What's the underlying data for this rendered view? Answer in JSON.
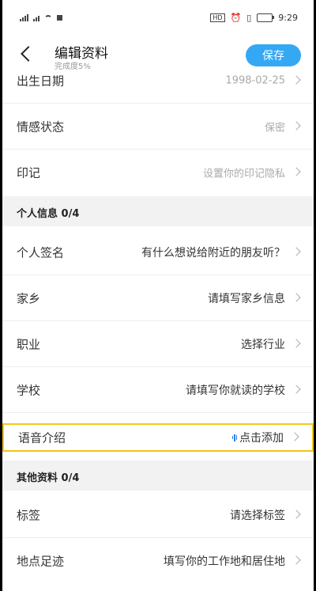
{
  "status": {
    "time": "9:29",
    "hd": "HD"
  },
  "header": {
    "title": "编辑资料",
    "completion": "完成度5%",
    "save_label": "保存"
  },
  "basic_rows": [
    {
      "label": "出生日期",
      "value": "1998-02-25"
    },
    {
      "label": "情感状态",
      "value": "保密"
    },
    {
      "label": "印记",
      "value": "设置你的印记隐私"
    }
  ],
  "personal_section": {
    "title": "个人信息 0/4"
  },
  "personal_rows": [
    {
      "label": "个人签名",
      "value": "有什么想说给附近的朋友听？"
    },
    {
      "label": "家乡",
      "value": "请填写家乡信息"
    },
    {
      "label": "职业",
      "value": "选择行业"
    },
    {
      "label": "学校",
      "value": "请填写你就读的学校"
    }
  ],
  "voice_row": {
    "label": "语音介绍",
    "value": "点击添加"
  },
  "other_section": {
    "title": "其他资料 0/4"
  },
  "other_rows": [
    {
      "label": "标签",
      "value": "请选择标签"
    },
    {
      "label": "地点足迹",
      "value": "填写你的工作地和居住地"
    }
  ],
  "colors": {
    "accent": "#35a8f4",
    "highlight": "#f5c518",
    "voice": "#2f7ee8"
  }
}
